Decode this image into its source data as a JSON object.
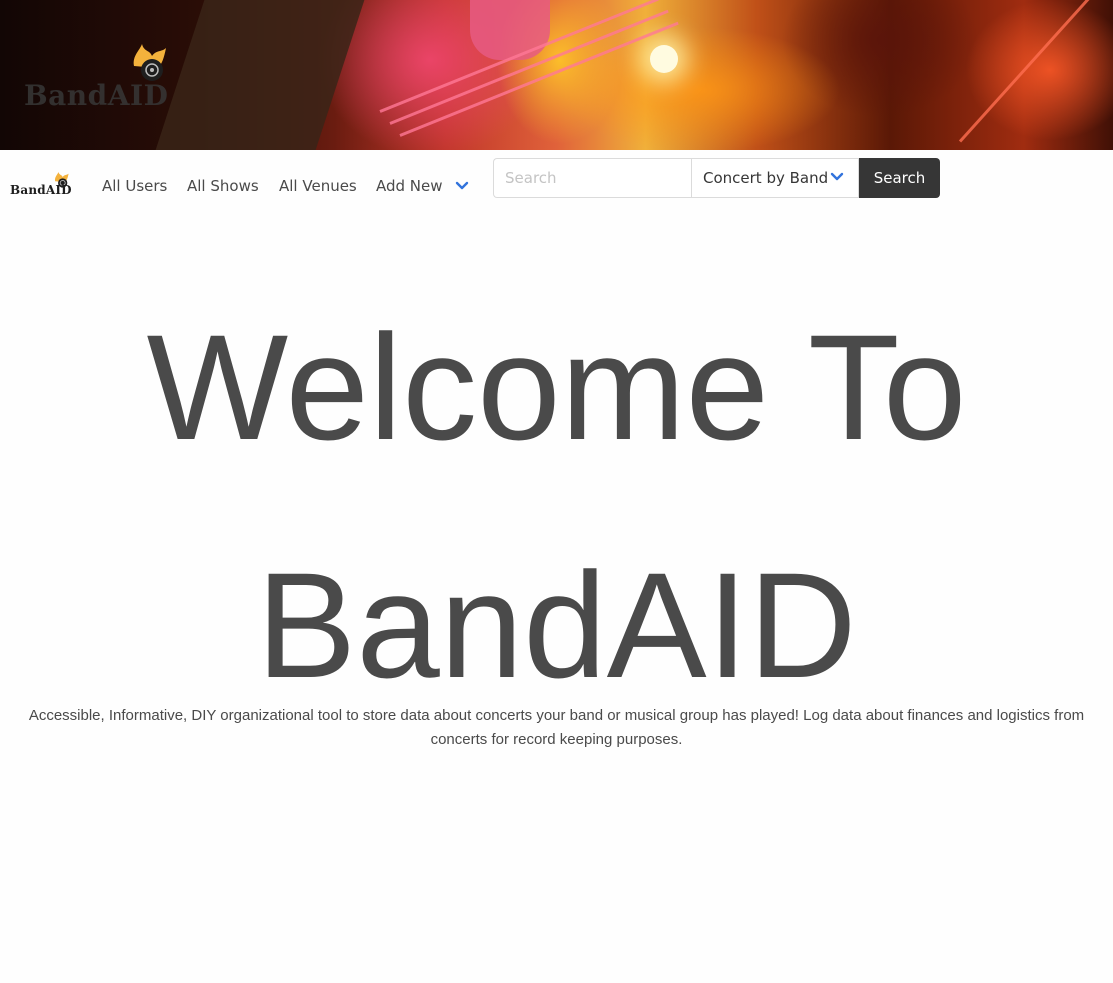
{
  "hero": {
    "logo_text": "BandAID"
  },
  "navbar": {
    "brand_text": "BandAID",
    "links": [
      {
        "label": "All Users"
      },
      {
        "label": "All Shows"
      },
      {
        "label": "All Venues"
      },
      {
        "label": "Add New",
        "icon": "chevron-down-icon"
      }
    ]
  },
  "search": {
    "placeholder": "Search",
    "value": "",
    "filter_selected": "Concert by Band",
    "button_label": "Search"
  },
  "main": {
    "title_line1": "Welcome To",
    "title_line2": "BandAID",
    "tagline": "Accessible, Informative, DIY organizational tool to store data about concerts your band or musical group has played! Log data about finances and logistics from concerts for record keeping purposes."
  },
  "colors": {
    "accent": "#3273dc",
    "text": "#4a4a4a",
    "button_bg": "#363636",
    "logo_flame": "#f4b23c"
  }
}
